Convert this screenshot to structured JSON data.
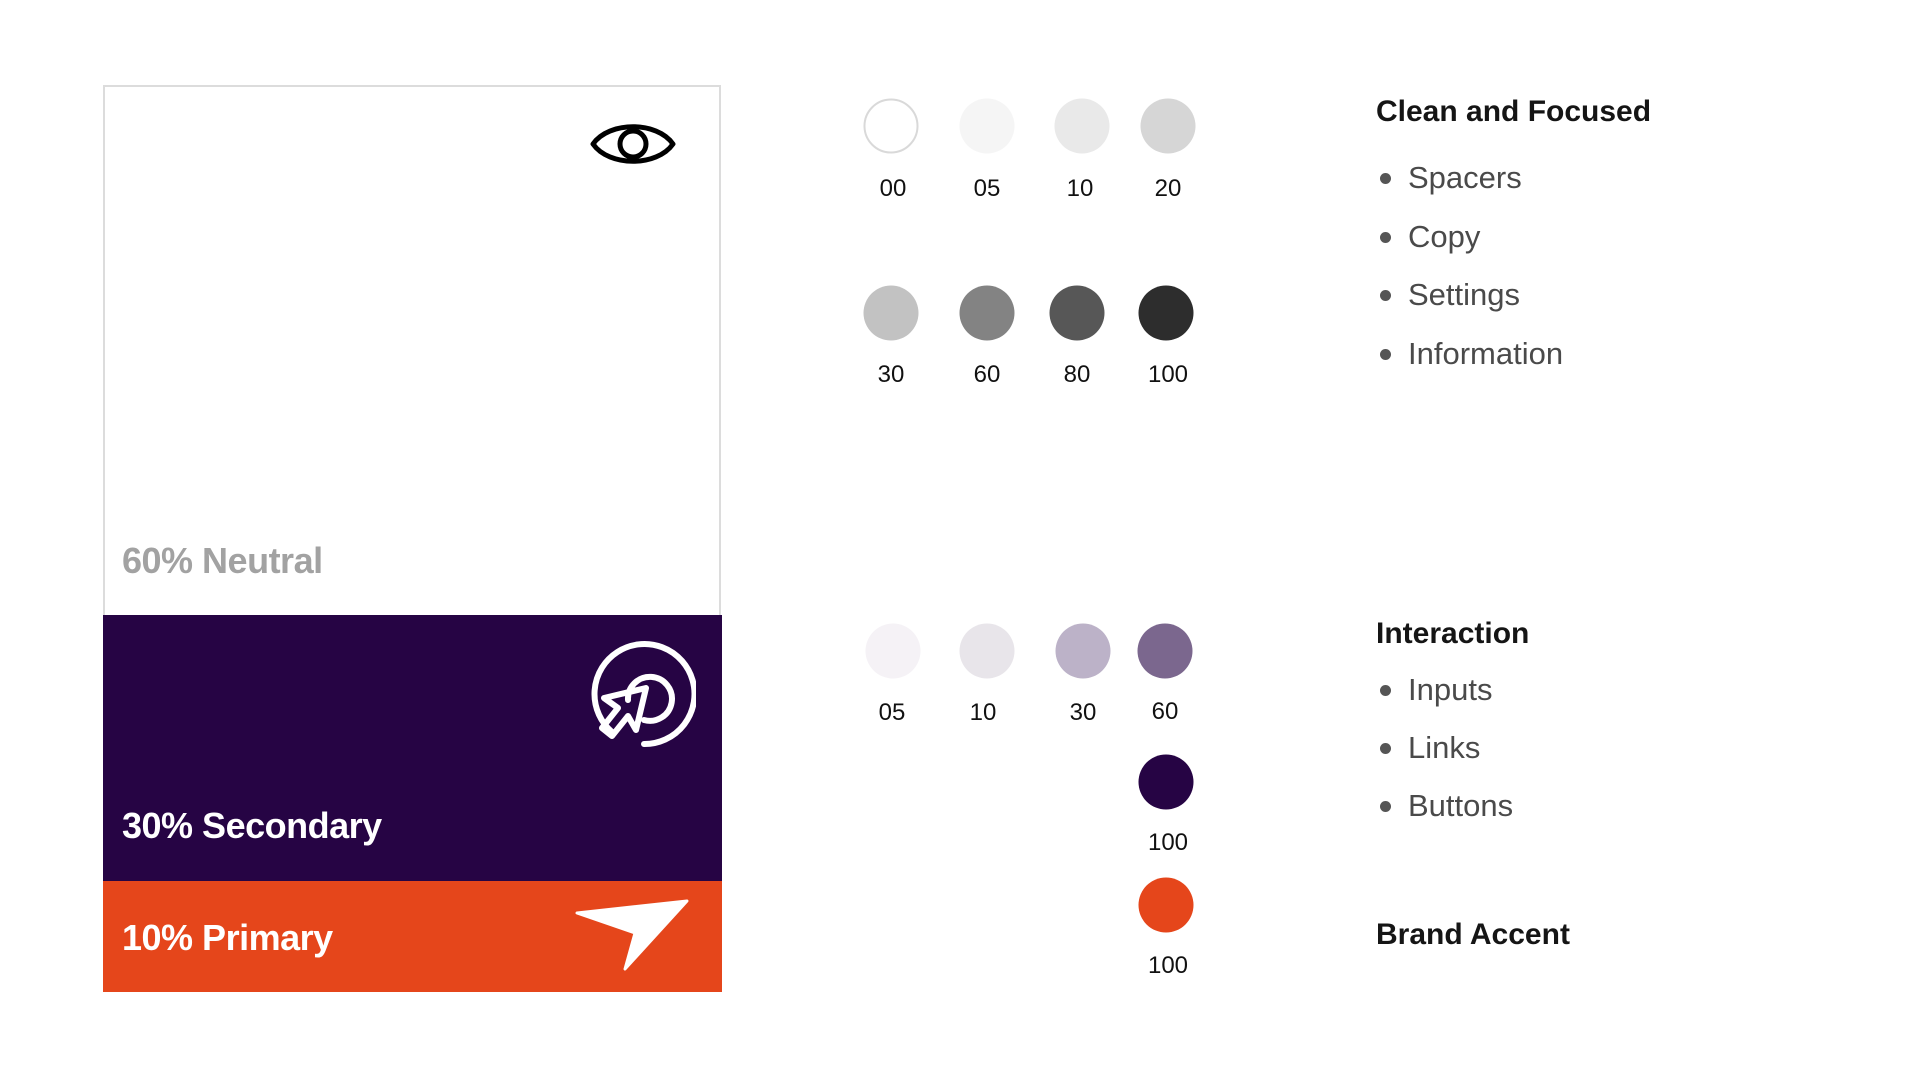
{
  "card": {
    "sections": [
      {
        "label": "60% Neutral",
        "share_percent": 60,
        "color": "#ffffff",
        "icon": "eye-icon"
      },
      {
        "label": "30% Secondary",
        "share_percent": 30,
        "color": "#260444",
        "icon": "target-cursor-icon"
      },
      {
        "label": "10% Primary",
        "share_percent": 10,
        "color": "#e5461b",
        "icon": "send-arrow-icon"
      }
    ]
  },
  "neutral_palette": {
    "row1": [
      {
        "label": "00",
        "color": "#ffffff"
      },
      {
        "label": "05",
        "color": "#f5f5f5"
      },
      {
        "label": "10",
        "color": "#e9e9e9"
      },
      {
        "label": "20",
        "color": "#d6d6d6"
      }
    ],
    "row2": [
      {
        "label": "30",
        "color": "#c2c2c2"
      },
      {
        "label": "60",
        "color": "#838383"
      },
      {
        "label": "80",
        "color": "#575757"
      },
      {
        "label": "100",
        "color": "#2d2d2d"
      }
    ]
  },
  "secondary_palette": [
    {
      "label": "05",
      "color": "#f5f2f6"
    },
    {
      "label": "10",
      "color": "#e8e5ea"
    },
    {
      "label": "30",
      "color": "#bcb2c8"
    },
    {
      "label": "60",
      "color": "#7b678e"
    },
    {
      "label": "100",
      "color": "#260444"
    }
  ],
  "primary_palette": [
    {
      "label": "100",
      "color": "#e5461b"
    }
  ],
  "descriptions": {
    "neutral": {
      "heading": "Clean and Focused",
      "items": [
        "Spacers",
        "Copy",
        "Settings",
        "Information"
      ]
    },
    "secondary": {
      "heading": "Interaction",
      "items": [
        "Inputs",
        "Links",
        "Buttons"
      ]
    },
    "primary": {
      "heading": "Brand Accent"
    }
  }
}
